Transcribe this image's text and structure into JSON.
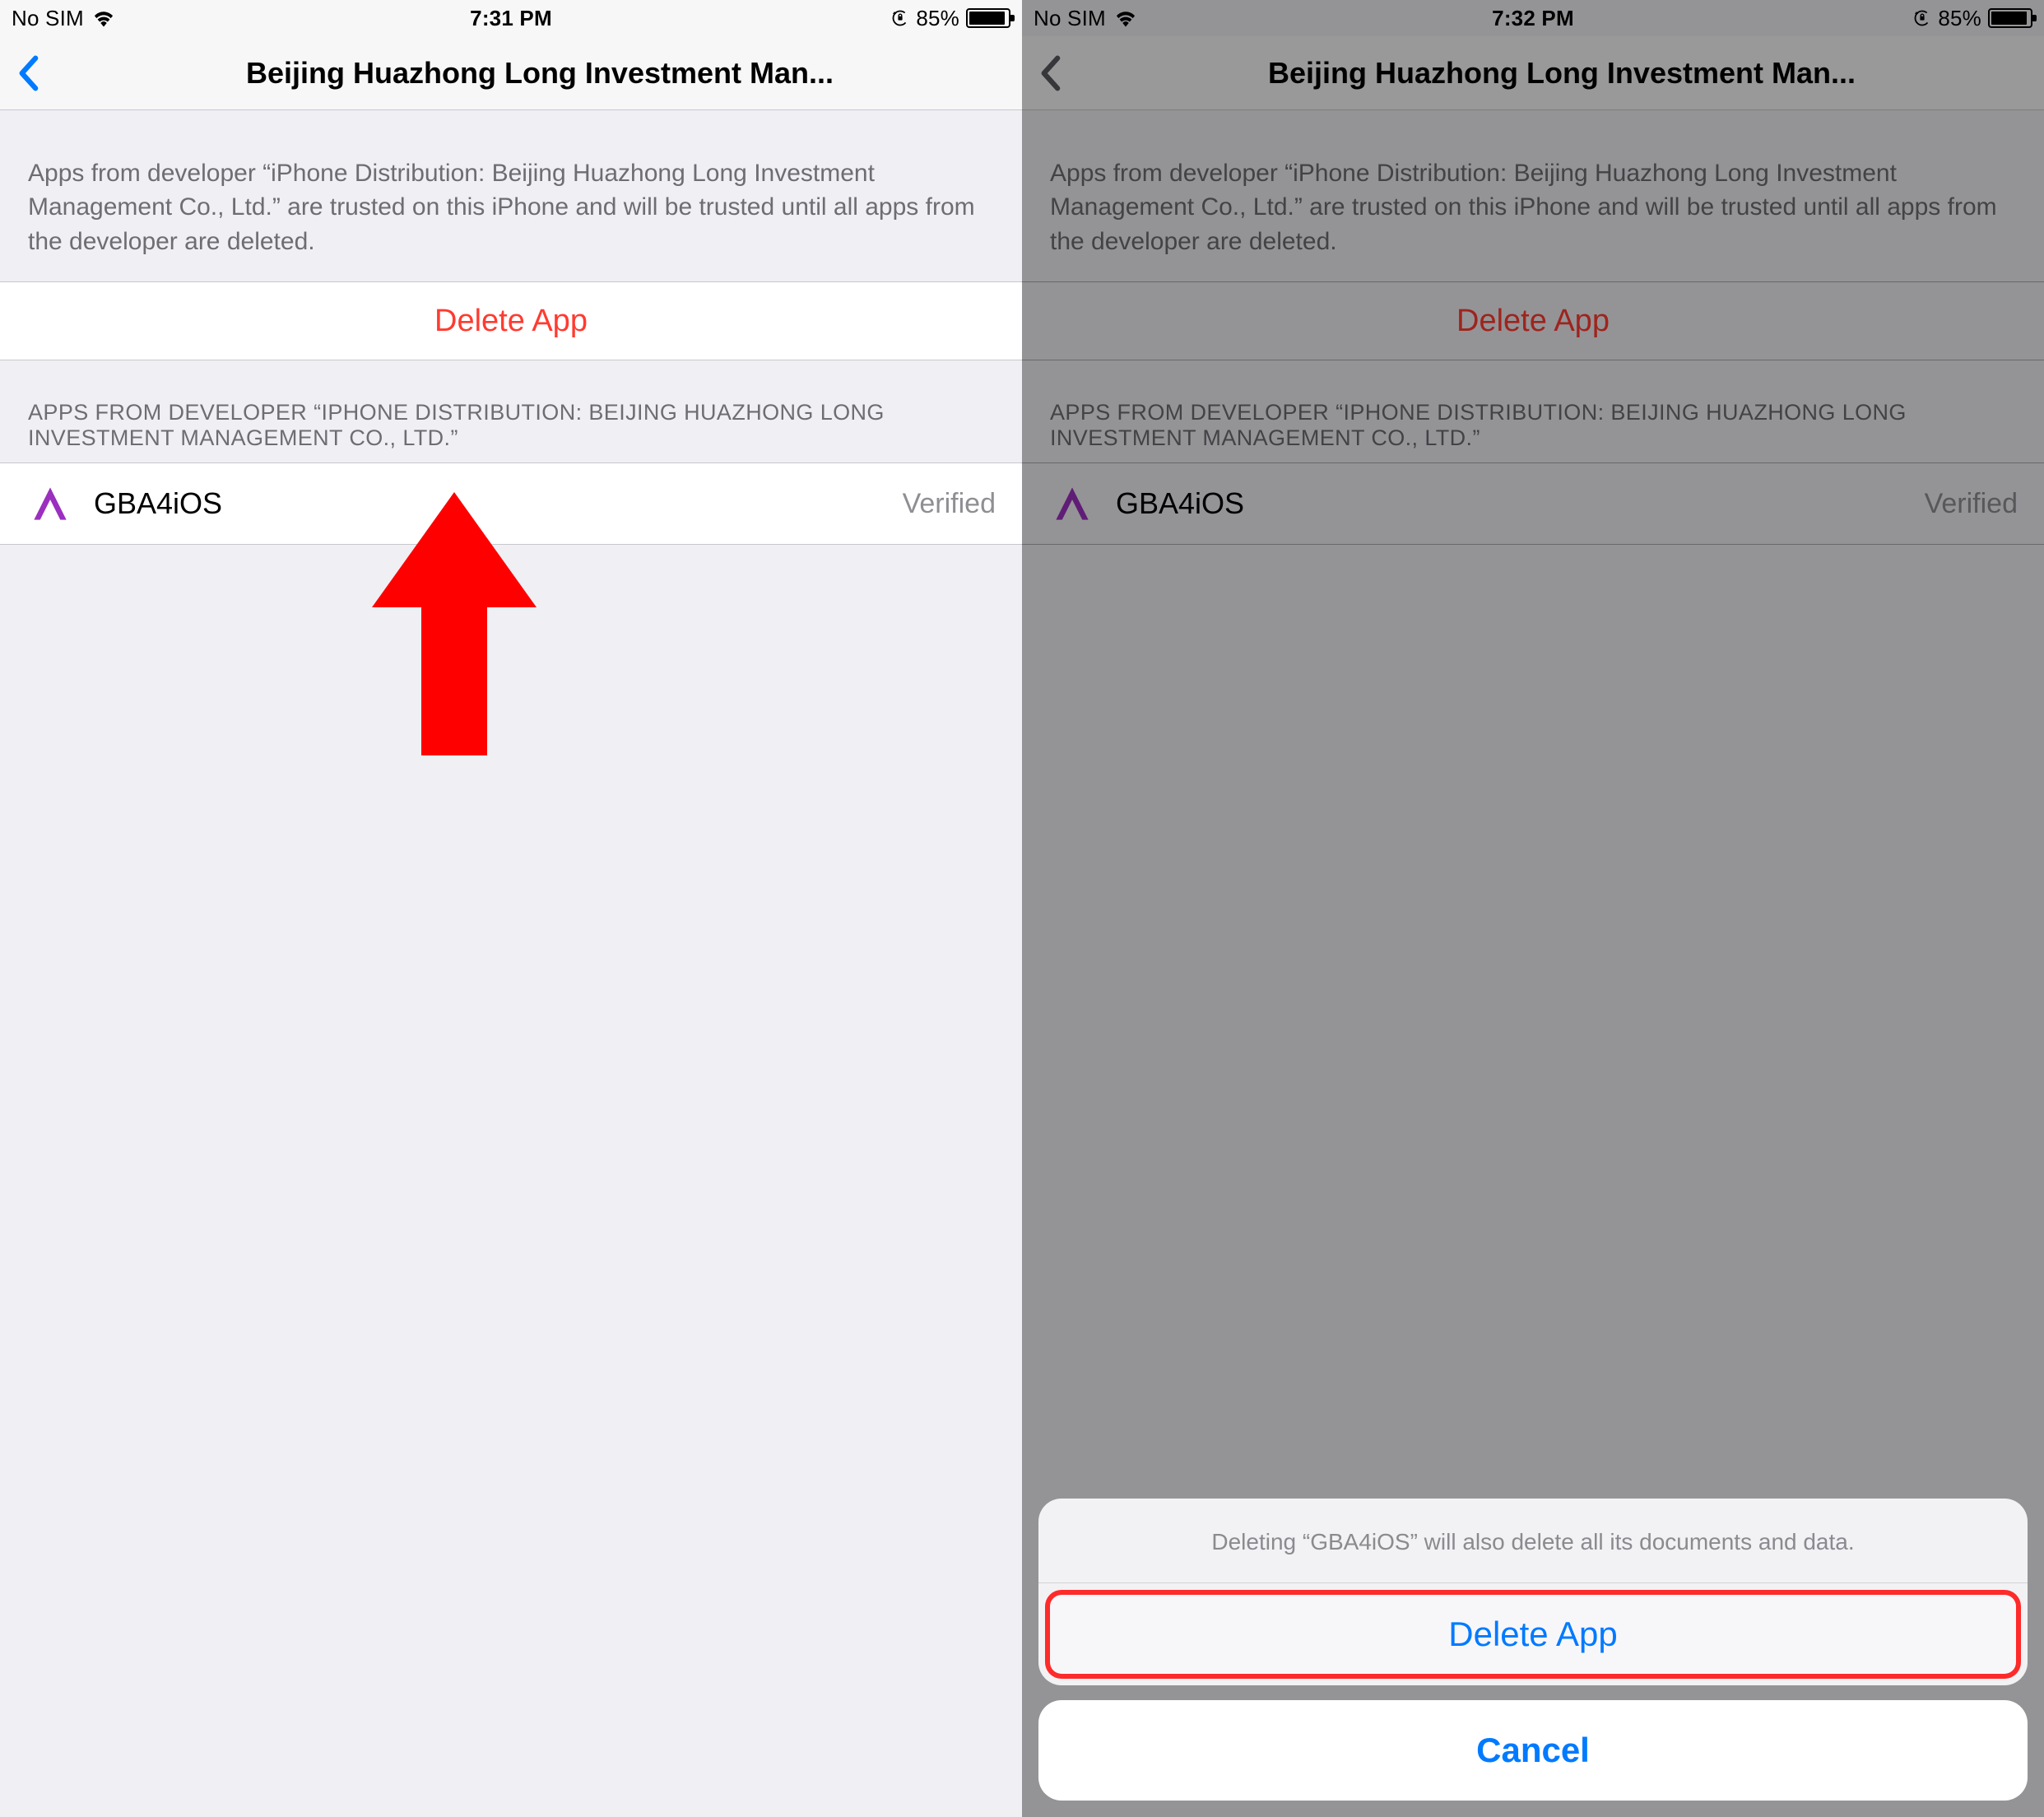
{
  "left": {
    "status": {
      "carrier": "No SIM",
      "time": "7:31 PM",
      "battery_pct": "85%"
    },
    "nav": {
      "title": "Beijing Huazhong Long Investment Man..."
    },
    "explain": "Apps from developer “iPhone Distribution: Beijing Huazhong Long Investment Management Co., Ltd.” are trusted on this iPhone and will be trusted until all apps from the developer are deleted.",
    "delete_label": "Delete App",
    "section_header": "APPS FROM DEVELOPER “IPHONE DISTRIBUTION: BEIJING HUAZHONG LONG INVESTMENT MANAGEMENT CO., LTD.”",
    "app": {
      "name": "GBA4iOS",
      "status": "Verified"
    }
  },
  "right": {
    "status": {
      "carrier": "No SIM",
      "time": "7:32 PM",
      "battery_pct": "85%"
    },
    "nav": {
      "title": "Beijing Huazhong Long Investment Man..."
    },
    "explain": "Apps from developer “iPhone Distribution: Beijing Huazhong Long Investment Management Co., Ltd.” are trusted on this iPhone and will be trusted until all apps from the developer are deleted.",
    "delete_label": "Delete App",
    "section_header": "APPS FROM DEVELOPER “IPHONE DISTRIBUTION: BEIJING HUAZHONG LONG INVESTMENT MANAGEMENT CO., LTD.”",
    "app": {
      "name": "GBA4iOS",
      "status": "Verified"
    },
    "sheet": {
      "message": "Deleting “GBA4iOS” will also delete all its documents and data.",
      "confirm_label": "Delete App",
      "cancel_label": "Cancel"
    }
  },
  "colors": {
    "destructive": "#ff3b30",
    "tint": "#007aff",
    "annotation_red": "#ff0000"
  }
}
